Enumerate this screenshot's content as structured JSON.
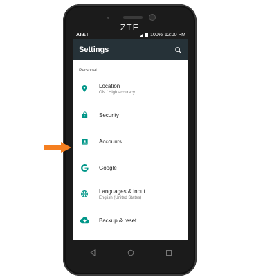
{
  "device": {
    "brand": "ZTE"
  },
  "status_bar": {
    "carrier": "AT&T",
    "battery": "100%",
    "time": "12:00 PM"
  },
  "app_bar": {
    "title": "Settings",
    "search_icon": "search-icon"
  },
  "section": {
    "label": "Personal"
  },
  "items": [
    {
      "title": "Location",
      "subtitle": "ON / High accuracy",
      "icon": "location-icon"
    },
    {
      "title": "Security",
      "subtitle": "",
      "icon": "lock-icon"
    },
    {
      "title": "Accounts",
      "subtitle": "",
      "icon": "accounts-icon"
    },
    {
      "title": "Google",
      "subtitle": "",
      "icon": "google-icon"
    },
    {
      "title": "Languages & input",
      "subtitle": "English (United States)",
      "icon": "globe-icon"
    },
    {
      "title": "Backup & reset",
      "subtitle": "",
      "icon": "cloud-upload-icon"
    }
  ],
  "colors": {
    "accent": "#009688",
    "app_bar": "#263238",
    "pointer": "#f57f20"
  }
}
